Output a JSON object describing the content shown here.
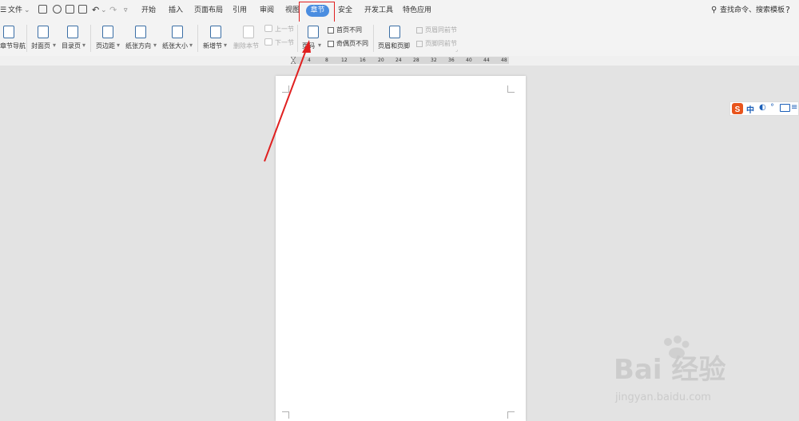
{
  "menubar": {
    "file_label": "文件",
    "tabs": [
      "开始",
      "插入",
      "页面布局",
      "引用",
      "审阅",
      "视图",
      "章节",
      "安全",
      "开发工具",
      "特色应用"
    ],
    "active_tab": "章节",
    "search_label": "查找命令、搜索模板",
    "help_label": "?"
  },
  "ribbon": {
    "nav_label": "章节导航",
    "cover_label": "封面页",
    "toc_label": "目录页",
    "margin_label": "页边距",
    "orientation_label": "纸张方向",
    "size_label": "纸张大小",
    "new_section_label": "新增节",
    "delete_section_label": "删除本节",
    "prev_section_label": "上一节",
    "next_section_label": "下一节",
    "page_number_label": "页码",
    "first_page_diff_label": "首页不同",
    "odd_even_diff_label": "奇偶页不同",
    "header_footer_label": "页眉和页脚",
    "header_same_label": "页眉同前节",
    "footer_same_label": "页脚同前节"
  },
  "ruler": {
    "ticks": [
      "4",
      "8",
      "12",
      "16",
      "20",
      "24",
      "28",
      "32",
      "36",
      "40",
      "44",
      "48"
    ]
  },
  "ime": {
    "mode_label": "中"
  },
  "watermark": {
    "brand": "Bai 经验",
    "url": "jingyan.baidu.com"
  },
  "colors": {
    "accent": "#4a8de0",
    "highlight": "#e02020",
    "arrow": "#e02020"
  }
}
